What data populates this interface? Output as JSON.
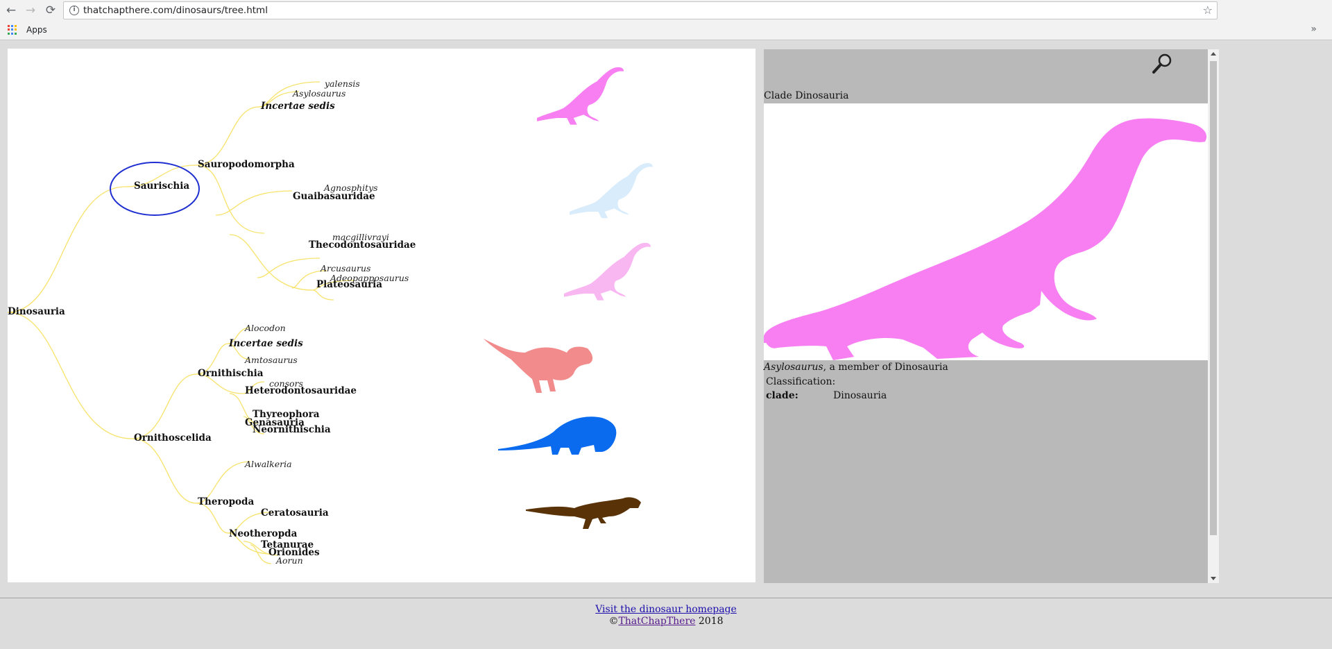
{
  "browser": {
    "url": "thatchapthere.com/dinosaurs/tree.html",
    "bookmark_apps": "Apps",
    "back_icon": "←",
    "forward_icon": "→",
    "reload_icon": "⟳",
    "info_icon": "i",
    "star_icon": "☆",
    "overflow_icon": "»"
  },
  "tree": {
    "root": "Dinosauria",
    "saurischia": "Saurischia",
    "sauropodomorpha": "Sauropodomorpha",
    "incertae1": "Incertae sedis",
    "yalensis": "yalensis",
    "asylosaurus": "Asylosaurus",
    "guaibasauridae": "Guaibasauridae",
    "agnosphitys": "Agnosphitys",
    "thecodontosauridae": "Thecodontosauridae",
    "macgillivrayi": "macgillivrayi",
    "arcusaurus": "Arcusaurus",
    "adeopapposaurus": "Adeopapposaurus",
    "plateosauria": "Plateosauria",
    "ornithoscelida": "Ornithoscelida",
    "ornithischia": "Ornithischia",
    "alocodon": "Alocodon",
    "incertae2": "Incertae sedis",
    "amtosaurus": "Amtosaurus",
    "consors": "consors",
    "heterodontosauridae": "Heterodontosauridae",
    "thyreophora": "Thyreophora",
    "genasauria": "Genasauria",
    "neornithischia": "Neornithischia",
    "alwalkeria": "Alwalkeria",
    "theropoda": "Theropoda",
    "ceratosauria": "Ceratosauria",
    "neotheropda": "Neotheropda",
    "tetanurae": "Tetanurae",
    "orionides": "Orionides",
    "aorun": "Aorun"
  },
  "colors": {
    "branch": "#f7e36a",
    "selected_ring": "#1f2fd1",
    "sauropodomorph_1": "#f77ff2",
    "sauropodomorph_2": "#d9ecfb",
    "sauropodomorph_3": "#f9b7f2",
    "ornithischian": "#f28b8b",
    "thyreophoran": "#0a6bef",
    "theropod": "#5a3208",
    "panel_bg": "#b9b9b9"
  },
  "silhouettes": [
    {
      "name": "sauropodomorph-silhouette",
      "color": "#f77ff2"
    },
    {
      "name": "sauropodomorph-silhouette",
      "color": "#d9ecfb"
    },
    {
      "name": "sauropodomorph-silhouette",
      "color": "#f9b7f2"
    },
    {
      "name": "ornithopod-silhouette",
      "color": "#f28b8b"
    },
    {
      "name": "ankylosaur-silhouette",
      "color": "#0a6bef"
    },
    {
      "name": "theropod-silhouette",
      "color": "#5a3208"
    }
  ],
  "info": {
    "search_icon": "magnifier-icon",
    "clade_title": "Clade Dinosauria",
    "caption_italic": "Asylosaurus",
    "caption_rest": ", a member of Dinosauria",
    "classification_label": "Classification:",
    "clade_key": "clade:",
    "clade_value": "Dinosauria"
  },
  "footer": {
    "home_link": "Visit the dinosaur homepage",
    "copyright_symbol": "©",
    "author_link": "ThatChapThere",
    "year": "2018"
  }
}
